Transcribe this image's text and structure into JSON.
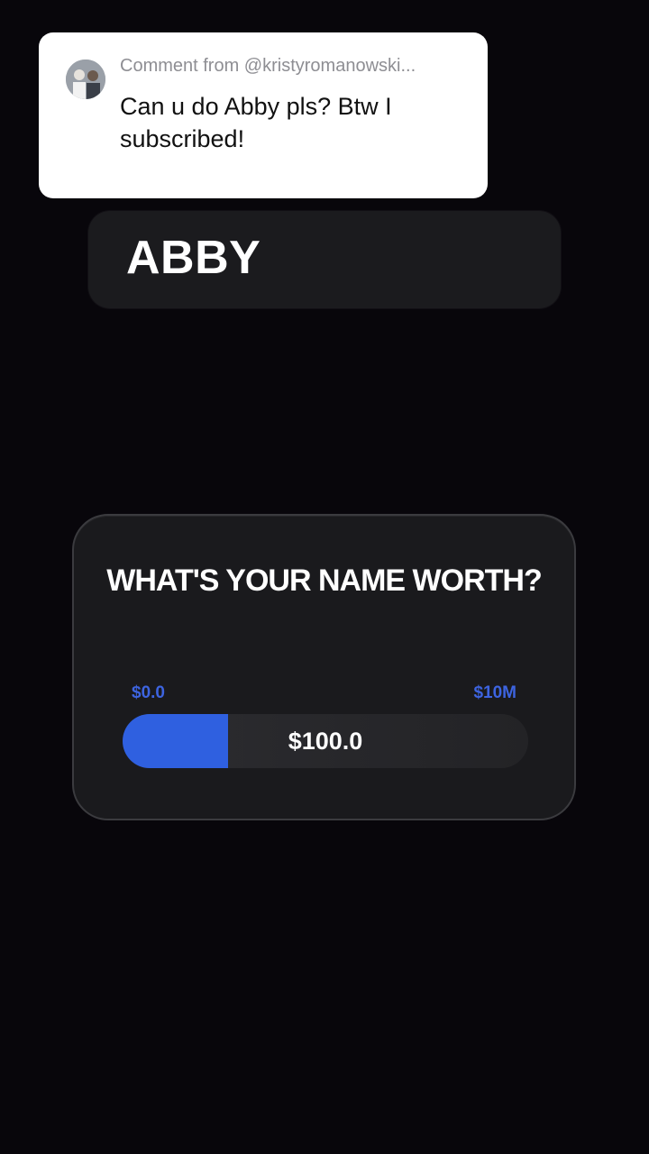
{
  "comment": {
    "header": "Comment from @kristyromanowski...",
    "body": "Can u do Abby pls? Btw I subscribed!",
    "avatar_icon": "user-avatar-photo"
  },
  "name_card": {
    "name": "ABBY"
  },
  "worth_widget": {
    "title": "WHAT'S YOUR NAME WORTH?",
    "range_min": "$0.0",
    "range_max": "$10M",
    "value": "$100.0",
    "fill_fraction": 0.26,
    "accent_color": "#2f60e0"
  }
}
